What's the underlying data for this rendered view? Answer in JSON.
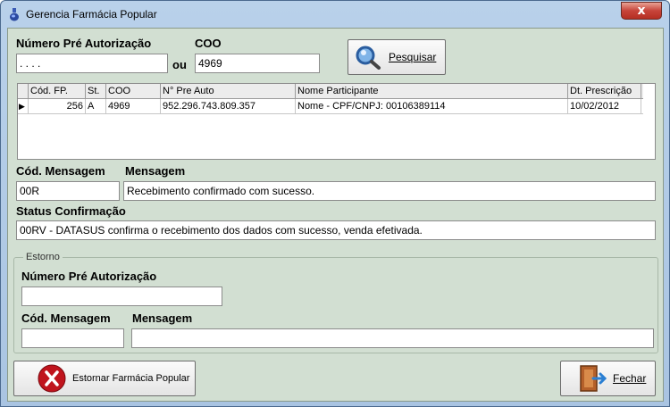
{
  "window": {
    "title": "Gerencia Farmácia Popular",
    "close_glyph": "x"
  },
  "search": {
    "numero_label": "Número Pré Autorização",
    "numero_value": " .  .  .  .",
    "ou_label": "ou",
    "coo_label": "COO",
    "coo_value": "4969",
    "pesquisar_label": "Pesquisar",
    "pesquisar_icon": "magnifier-icon"
  },
  "grid": {
    "columns": [
      "Cód. FP.",
      "St.",
      "COO",
      "N° Pre Auto",
      "Nome Participante",
      "Dt. Prescrição"
    ],
    "rows": [
      {
        "indicator": "▶",
        "cod_fp": "256",
        "st": "A",
        "coo": "4969",
        "n_pre_auto": "952.296.743.809.357",
        "nome": "Nome - CPF/CNPJ: 00106389114",
        "dt_prescricao": "10/02/2012"
      }
    ]
  },
  "mensagem": {
    "cod_label": "Cód.  Mensagem",
    "msg_label": "Mensagem",
    "cod_value": "00R",
    "msg_value": "Recebimento confirmado com sucesso."
  },
  "status": {
    "label": "Status Confirmação",
    "value": "00RV - DATASUS confirma o recebimento dos dados com sucesso, venda efetivada."
  },
  "estorno": {
    "legend": "Estorno",
    "numero_label": "Número Pré Autorização",
    "numero_value": "",
    "cod_label": "Cód.  Mensagem",
    "msg_label": "Mensagem",
    "cod_value": "",
    "msg_value": ""
  },
  "footer": {
    "estornar_label": "Estornar Farmácia Popular",
    "estornar_icon": "cancel-icon",
    "fechar_label": "Fechar",
    "fechar_icon": "exit-door-icon"
  }
}
